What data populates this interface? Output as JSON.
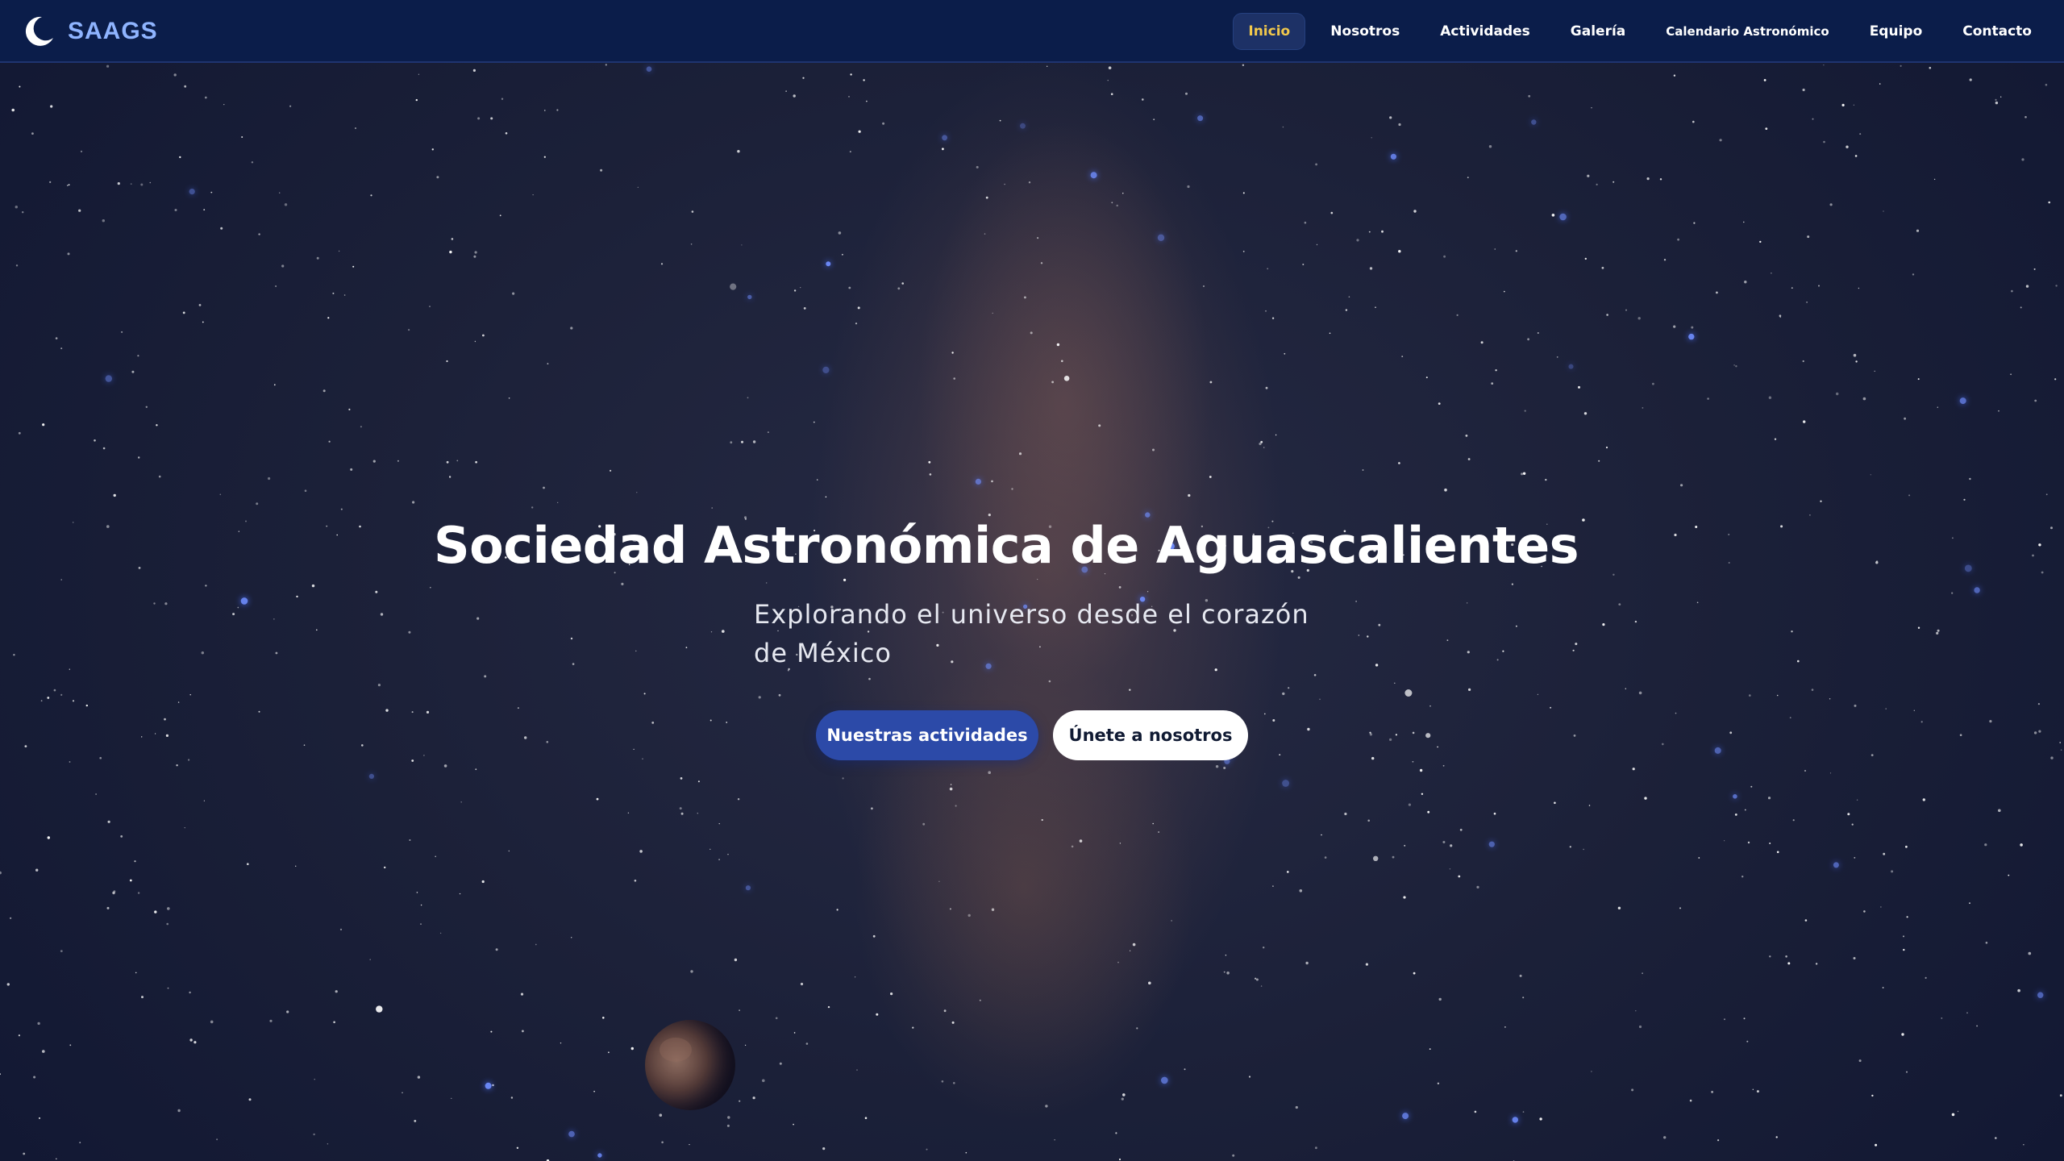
{
  "brand": {
    "logo_icon": "crescent-moon-icon",
    "name": "SAAGS",
    "accent_color": "#8fb4ff"
  },
  "nav": {
    "items": [
      {
        "label": "Inicio",
        "active": true
      },
      {
        "label": "Nosotros",
        "active": false
      },
      {
        "label": "Actividades",
        "active": false
      },
      {
        "label": "Galería",
        "active": false
      },
      {
        "label": "Calendario Astronómico",
        "active": false
      },
      {
        "label": "Equipo",
        "active": false
      },
      {
        "label": "Contacto",
        "active": false
      }
    ],
    "active_color": "#f2c94c",
    "background": "#0b1d4a"
  },
  "hero": {
    "title": "Sociedad Astronómica de Aguascalientes",
    "subtitle": "Explorando el universo desde el corazón de México",
    "primary_button": "Nuestras actividades",
    "secondary_button": "Únete a nosotros",
    "primary_color": "#2c4aa8"
  }
}
